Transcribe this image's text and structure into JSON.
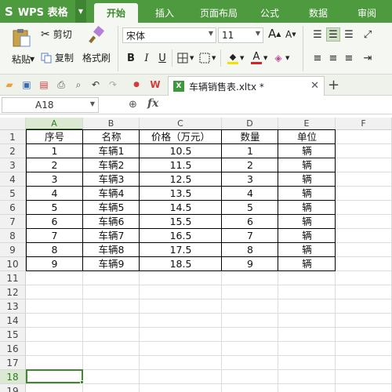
{
  "app": {
    "name": "WPS 表格",
    "logo_glyph": "S"
  },
  "tabs": [
    {
      "label": "开始",
      "active": true
    },
    {
      "label": "插入",
      "active": false
    },
    {
      "label": "页面布局",
      "active": false
    },
    {
      "label": "公式",
      "active": false
    },
    {
      "label": "数据",
      "active": false
    },
    {
      "label": "审阅",
      "active": false
    }
  ],
  "ribbon": {
    "paste": "粘贴",
    "cut": "剪切",
    "copy": "复制",
    "format_painter": "格式刷",
    "font_name": "宋体",
    "font_size": "11",
    "bold": "B",
    "italic": "I",
    "underline": "U",
    "font_color_glyph": "A",
    "grow_glyph": "A",
    "shrink_glyph": "A"
  },
  "document": {
    "tab_title": "车辆销售表.xltx *",
    "file_badge": "X"
  },
  "formula_bar": {
    "name_box": "A18",
    "fx": "fx",
    "value": ""
  },
  "grid": {
    "columns": [
      "A",
      "B",
      "C",
      "D",
      "E",
      "F"
    ],
    "selected_column": "A",
    "row_numbers": [
      "1",
      "2",
      "3",
      "4",
      "5",
      "6",
      "7",
      "8",
      "9",
      "10",
      "11",
      "12",
      "13",
      "14",
      "15",
      "16",
      "17",
      "18",
      "19"
    ],
    "selected_row": "18",
    "header": [
      "序号",
      "名称",
      "价格（万元）",
      "数量",
      "单位"
    ],
    "rows": [
      [
        "1",
        "车辆1",
        "10.5",
        "1",
        "辆"
      ],
      [
        "2",
        "车辆2",
        "11.5",
        "2",
        "辆"
      ],
      [
        "3",
        "车辆3",
        "12.5",
        "3",
        "辆"
      ],
      [
        "4",
        "车辆4",
        "13.5",
        "4",
        "辆"
      ],
      [
        "5",
        "车辆5",
        "14.5",
        "5",
        "辆"
      ],
      [
        "6",
        "车辆6",
        "15.5",
        "6",
        "辆"
      ],
      [
        "7",
        "车辆7",
        "16.5",
        "7",
        "辆"
      ],
      [
        "8",
        "车辆8",
        "17.5",
        "8",
        "辆"
      ],
      [
        "9",
        "车辆9",
        "18.5",
        "9",
        "辆"
      ]
    ]
  },
  "colors": {
    "brand": "#4e9a3e",
    "accent": "#3d8a2e"
  }
}
